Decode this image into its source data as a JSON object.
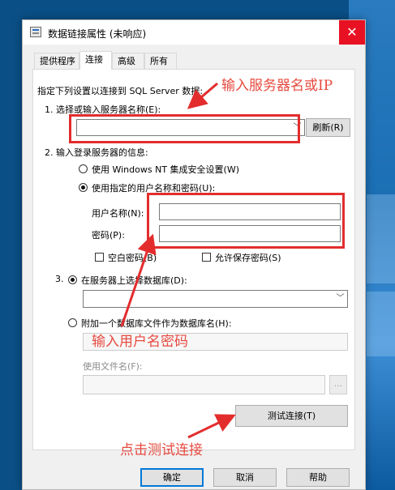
{
  "window": {
    "title": "数据链接属性 (未响应)",
    "close_glyph": "✕"
  },
  "tabs": [
    {
      "label": "提供程序",
      "active": false
    },
    {
      "label": "连接",
      "active": true
    },
    {
      "label": "高级",
      "active": false
    },
    {
      "label": "所有",
      "active": false
    }
  ],
  "connection": {
    "intro": "指定下列设置以连接到 SQL Server 数据:",
    "step1_label": "1. 选择或输入服务器名称(E):",
    "server_name_value": "",
    "refresh_label": "刷新(R)",
    "step2_label": "2. 输入登录服务器的信息:",
    "login_nt_label": "使用 Windows NT 集成安全设置(W)",
    "login_sql_label": "使用指定的用户名称和密码(U):",
    "username_label": "用户名称(N):",
    "username_value": "",
    "password_label": "密码(P):",
    "password_value": "",
    "blank_password_label": "空白密码(B)",
    "save_password_label": "允许保存密码(S)",
    "step3_db_label": "在服务器上选择数据库(D):",
    "step3_prefix": "3.",
    "database_value": "",
    "attach_label": "附加一个数据库文件作为数据库名(H):",
    "attach_value": "",
    "filename_label": "使用文件名(F):",
    "filename_value": "",
    "browse_label": "...",
    "test_label": "测试连接(T)"
  },
  "dialog_buttons": {
    "ok_label": "确定",
    "cancel_label": "取消",
    "help_label": "帮助"
  },
  "annotations": {
    "server_hint": "输入服务器名或IP",
    "credentials_hint": "输入用户名密码",
    "test_hint": "点击测试连接"
  },
  "colors": {
    "annotation_red": "#e32d2d",
    "close_red": "#e81123",
    "desktop_blue": "#0a4f86"
  },
  "state": {
    "login_mode": "sql",
    "blank_password_checked": false,
    "save_password_checked": false,
    "db_source": "server"
  }
}
